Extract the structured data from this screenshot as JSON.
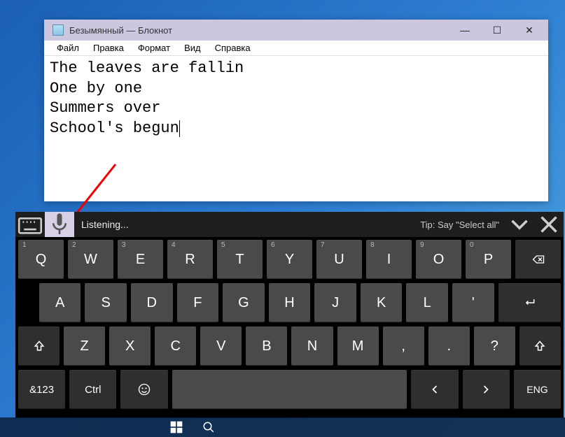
{
  "notepad": {
    "title": "Безымянный — Блокнот",
    "menus": [
      "Файл",
      "Правка",
      "Формат",
      "Вид",
      "Справка"
    ],
    "content": "The leaves are fallin\nOne by one\nSummers over\nSchool's begun"
  },
  "osk": {
    "status": "Listening...",
    "tip": "Tip: Say \"Select all\"",
    "row1": [
      {
        "key": "Q",
        "sup": "1"
      },
      {
        "key": "W",
        "sup": "2"
      },
      {
        "key": "E",
        "sup": "3"
      },
      {
        "key": "R",
        "sup": "4"
      },
      {
        "key": "T",
        "sup": "5"
      },
      {
        "key": "Y",
        "sup": "6"
      },
      {
        "key": "U",
        "sup": "7"
      },
      {
        "key": "I",
        "sup": "8"
      },
      {
        "key": "O",
        "sup": "9"
      },
      {
        "key": "P",
        "sup": "0"
      }
    ],
    "row2": [
      "A",
      "S",
      "D",
      "F",
      "G",
      "H",
      "J",
      "K",
      "L",
      "'"
    ],
    "row3_letters": [
      "Z",
      "X",
      "C",
      "V",
      "B",
      "N",
      "M",
      ",",
      ".",
      "?"
    ],
    "bottom": {
      "mode": "&123",
      "ctrl": "Ctrl",
      "lang": "ENG"
    },
    "icons": {
      "shift": "shift-icon",
      "backspace": "backspace-icon",
      "enter": "enter-icon",
      "emoji": "emoji-icon",
      "left": "arrow-left-icon",
      "right": "arrow-right-icon",
      "mic": "microphone-icon",
      "kbswitch": "keyboard-switch-icon",
      "chevron": "chevron-down-icon",
      "close": "close-icon"
    }
  }
}
